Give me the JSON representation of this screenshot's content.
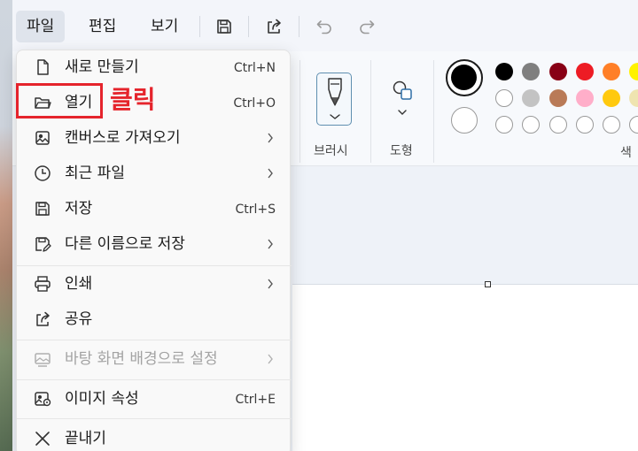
{
  "menu": {
    "file": "파일",
    "edit": "편집",
    "view": "보기"
  },
  "toolbar": {
    "icons": [
      "save-icon",
      "share-icon",
      "undo-icon",
      "redo-icon"
    ]
  },
  "ribbon": {
    "brushes_label": "브러시",
    "shapes_label": "도형",
    "colors_label": "색"
  },
  "palette": {
    "primary": "#000000",
    "secondary": "#ffffff",
    "row1": [
      "#000000",
      "#7f7f7f",
      "#880015",
      "#ed1c24",
      "#ff7f27",
      "#fff200"
    ],
    "row2": [
      "#ffffff",
      "#c3c3c3",
      "#b97a57",
      "#ffaec9",
      "#ffc90e",
      "#efe4b0"
    ],
    "row3": [
      "#ffffff",
      "#ffffff",
      "#ffffff",
      "#ffffff",
      "#ffffff",
      "#ffffff"
    ]
  },
  "file_menu": {
    "new": {
      "label": "새로 만들기",
      "shortcut": "Ctrl+N"
    },
    "open": {
      "label": "열기",
      "shortcut": "Ctrl+O"
    },
    "import": {
      "label": "캔버스로 가져오기"
    },
    "recent": {
      "label": "최근 파일"
    },
    "save": {
      "label": "저장",
      "shortcut": "Ctrl+S"
    },
    "save_as": {
      "label": "다른 이름으로 저장"
    },
    "print": {
      "label": "인쇄"
    },
    "share": {
      "label": "공유"
    },
    "wallpaper": {
      "label": "바탕 화면 배경으로 설정"
    },
    "properties": {
      "label": "이미지 속성",
      "shortcut": "Ctrl+E"
    },
    "exit": {
      "label": "끝내기"
    }
  },
  "annotation": {
    "click_text": "클릭",
    "color": "#e5242c"
  }
}
